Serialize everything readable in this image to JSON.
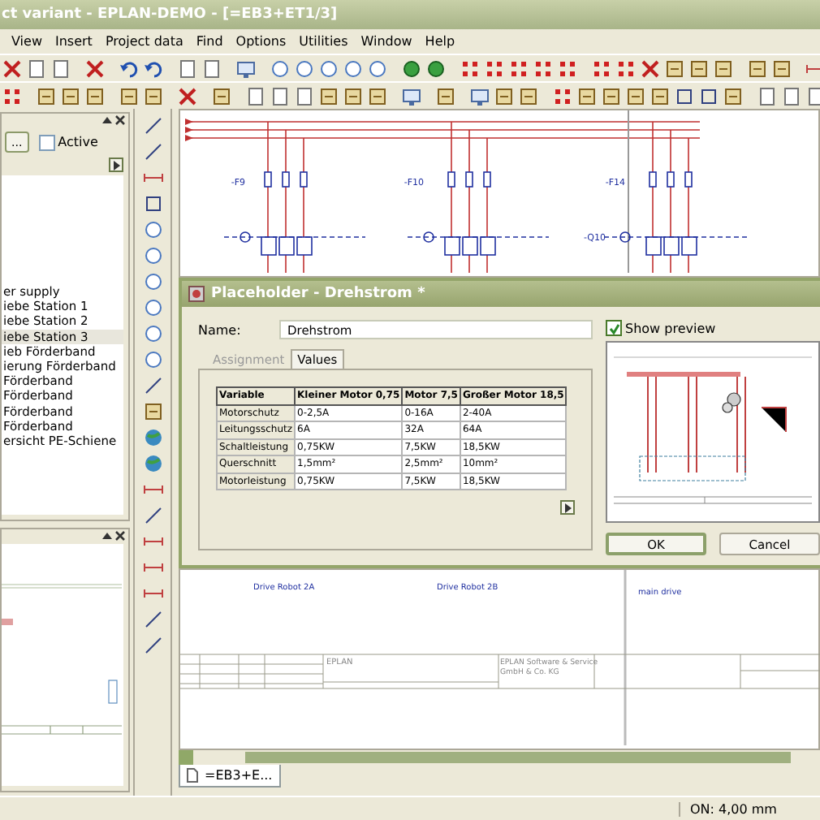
{
  "window": {
    "title": "ct variant - EPLAN-DEMO - [=EB3+ET1/3]"
  },
  "menu": [
    "View",
    "Insert",
    "Project data",
    "Find",
    "Options",
    "Utilities",
    "Window",
    "Help"
  ],
  "left_panel": {
    "more_button": "...",
    "active": {
      "label": "Active",
      "checked": false
    },
    "items": [
      {
        "label": "er supply",
        "selected": false
      },
      {
        "label": "iebe Station 1",
        "selected": false
      },
      {
        "label": "iebe Station 2",
        "selected": false
      },
      {
        "label": "iebe Station 3",
        "selected": true
      },
      {
        "label": "ieb Förderband",
        "selected": false
      },
      {
        "label": "ierung Förderband",
        "selected": false
      },
      {
        "label": "Förderband",
        "selected": false
      },
      {
        "label": "Förderband",
        "selected": false
      },
      {
        "label": "Förderband",
        "selected": false
      },
      {
        "label": "Förderband",
        "selected": false
      },
      {
        "label": "ersicht PE-Schiene",
        "selected": false
      }
    ]
  },
  "schematic": {
    "fuses": [
      "-F9",
      "-F10",
      "-F14"
    ],
    "breakers": [
      "-Q10"
    ]
  },
  "dialog": {
    "title": "Placeholder - Drehstrom *",
    "name_label": "Name:",
    "name_value": "Drehstrom",
    "show_preview": {
      "label": "Show preview",
      "checked": true
    },
    "tabs": [
      {
        "label": "Assignment",
        "selected": false
      },
      {
        "label": "Values",
        "selected": true
      }
    ],
    "table": {
      "columns": [
        "Variable",
        "Kleiner Motor 0,75",
        "Motor 7,5",
        "Großer Motor 18,5"
      ],
      "rows": [
        [
          "Motorschutz",
          "0-2,5A",
          "0-16A",
          "2-40A"
        ],
        [
          "Leitungsschutz",
          "6A",
          "32A",
          "64A"
        ],
        [
          "Schaltleistung",
          "0,75KW",
          "7,5KW",
          "18,5KW"
        ],
        [
          "Querschnitt",
          "1,5mm²",
          "2,5mm²",
          "10mm²"
        ],
        [
          "Motorleistung",
          "0,75KW",
          "7,5KW",
          "18,5KW"
        ]
      ]
    },
    "buttons": [
      {
        "label": "OK",
        "default": true
      },
      {
        "label": "Cancel",
        "default": false
      }
    ]
  },
  "drawing": {
    "labels": [
      "Drive  Robot 2A",
      "Drive  Robot 2B",
      "main drive"
    ],
    "title_block": [
      "EPLAN",
      "EPLAN Software & Service",
      "GmbH & Co. KG"
    ]
  },
  "page_tabs": [
    {
      "label": "=EB3+E...",
      "selected": true
    }
  ],
  "status_bar": {
    "reading": "ON: 4,00 mm"
  }
}
